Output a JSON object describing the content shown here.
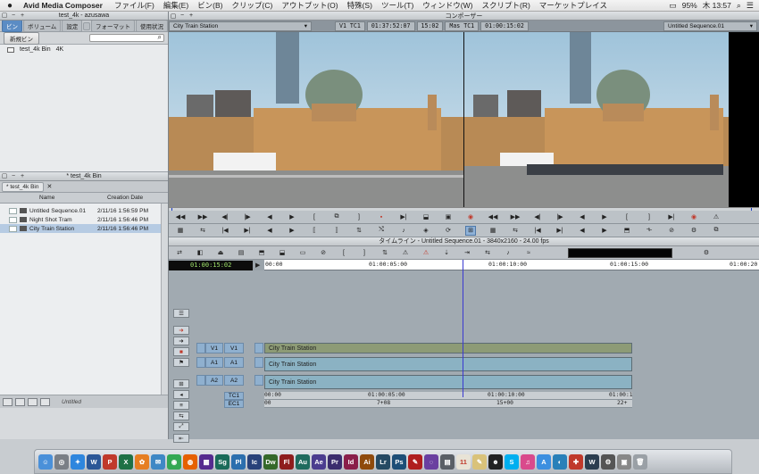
{
  "menubar": {
    "apple": "",
    "app_name": "Avid Media Composer",
    "items": [
      "ファイル(F)",
      "編集(E)",
      "ビン(B)",
      "クリップ(C)",
      "アウトプット(O)",
      "特殊(S)",
      "ツール(T)",
      "ウィンドウ(W)",
      "スクリプト(R)",
      "マーケットプレイス"
    ],
    "battery": "95%",
    "clock": "木 13:57"
  },
  "project_window": {
    "title": "test_4k - azusawa",
    "tabs": [
      "ビン",
      "ボリューム",
      "設定",
      "",
      "フォーマット",
      "使用状況"
    ],
    "new_bin_label": "新規ビン",
    "bins": [
      {
        "name": "test_4k Bin",
        "format": "4K"
      }
    ]
  },
  "bin_window": {
    "title": "* test_4k Bin",
    "tab": "* test_4k Bin",
    "columns": [
      "Name",
      "Creation Date"
    ],
    "items": [
      {
        "name": "Untitled Sequence.01",
        "date": "2/11/16 1:56:59 PM",
        "selected": false
      },
      {
        "name": "Night Shot Tram",
        "date": "2/11/16 1:56:46 PM",
        "selected": false
      },
      {
        "name": "City Train Station",
        "date": "2/11/16 1:56:46 PM",
        "selected": true
      }
    ],
    "footer_view": "Untitled"
  },
  "composer": {
    "title": "コンポーザー",
    "source_name": "City Train Station",
    "source_track": "V1 TC1",
    "source_tc": "01:37:52:07",
    "source_dur": "15:02",
    "record_track": "Mas TC1",
    "record_tc": "01:00:15:02",
    "sequence_name": "Untitled Sequence.01"
  },
  "timeline": {
    "title": "タイムライン - Untitled Sequence.01 - 3840x2160 - 24.00 fps",
    "current_tc": "01:00:15:02",
    "ruler_labels": [
      "00:00",
      "01:00:05:00",
      "01:00:10:00",
      "01:00:15:00",
      "01:00:20"
    ],
    "tracks": [
      {
        "src": "V1",
        "rec": "V1",
        "clip": "City Train Station",
        "kind": "video"
      },
      {
        "src": "A1",
        "rec": "A1",
        "clip": "City Train Station",
        "kind": "audio"
      },
      {
        "src": "A2",
        "rec": "A2",
        "clip": "City Train Station",
        "kind": "audio"
      }
    ],
    "tc1_label": "TC1",
    "ec1_label": "EC1",
    "tc1_values": [
      "00:00",
      "01:00:05:00",
      "01:00:10:00",
      "01:00:1"
    ],
    "ec1_values": [
      "00",
      "7+08",
      "15+00",
      "22+"
    ]
  },
  "dock": {
    "apps": [
      "Finder",
      "Launchpad",
      "Safari",
      "Word",
      "PowerPoint",
      "Excel",
      "Photos",
      "Mail",
      "Chrome",
      "Firefox",
      "Avid",
      "Sg",
      "Pl",
      "Ic",
      "Dw",
      "Fl",
      "Au",
      "Ae",
      "Pr",
      "Id",
      "Ai",
      "Lr",
      "Ps",
      "Acrobat",
      "Calendar",
      "Notes",
      "Skype",
      "iTunes",
      "App Store",
      "W",
      "Prefs",
      "Trash"
    ]
  },
  "colors": {
    "accent_blue": "#5b8cc4",
    "video_clip": "#8d9b76",
    "audio_clip": "#8bb2c3",
    "tc_green": "#9fe36a"
  }
}
